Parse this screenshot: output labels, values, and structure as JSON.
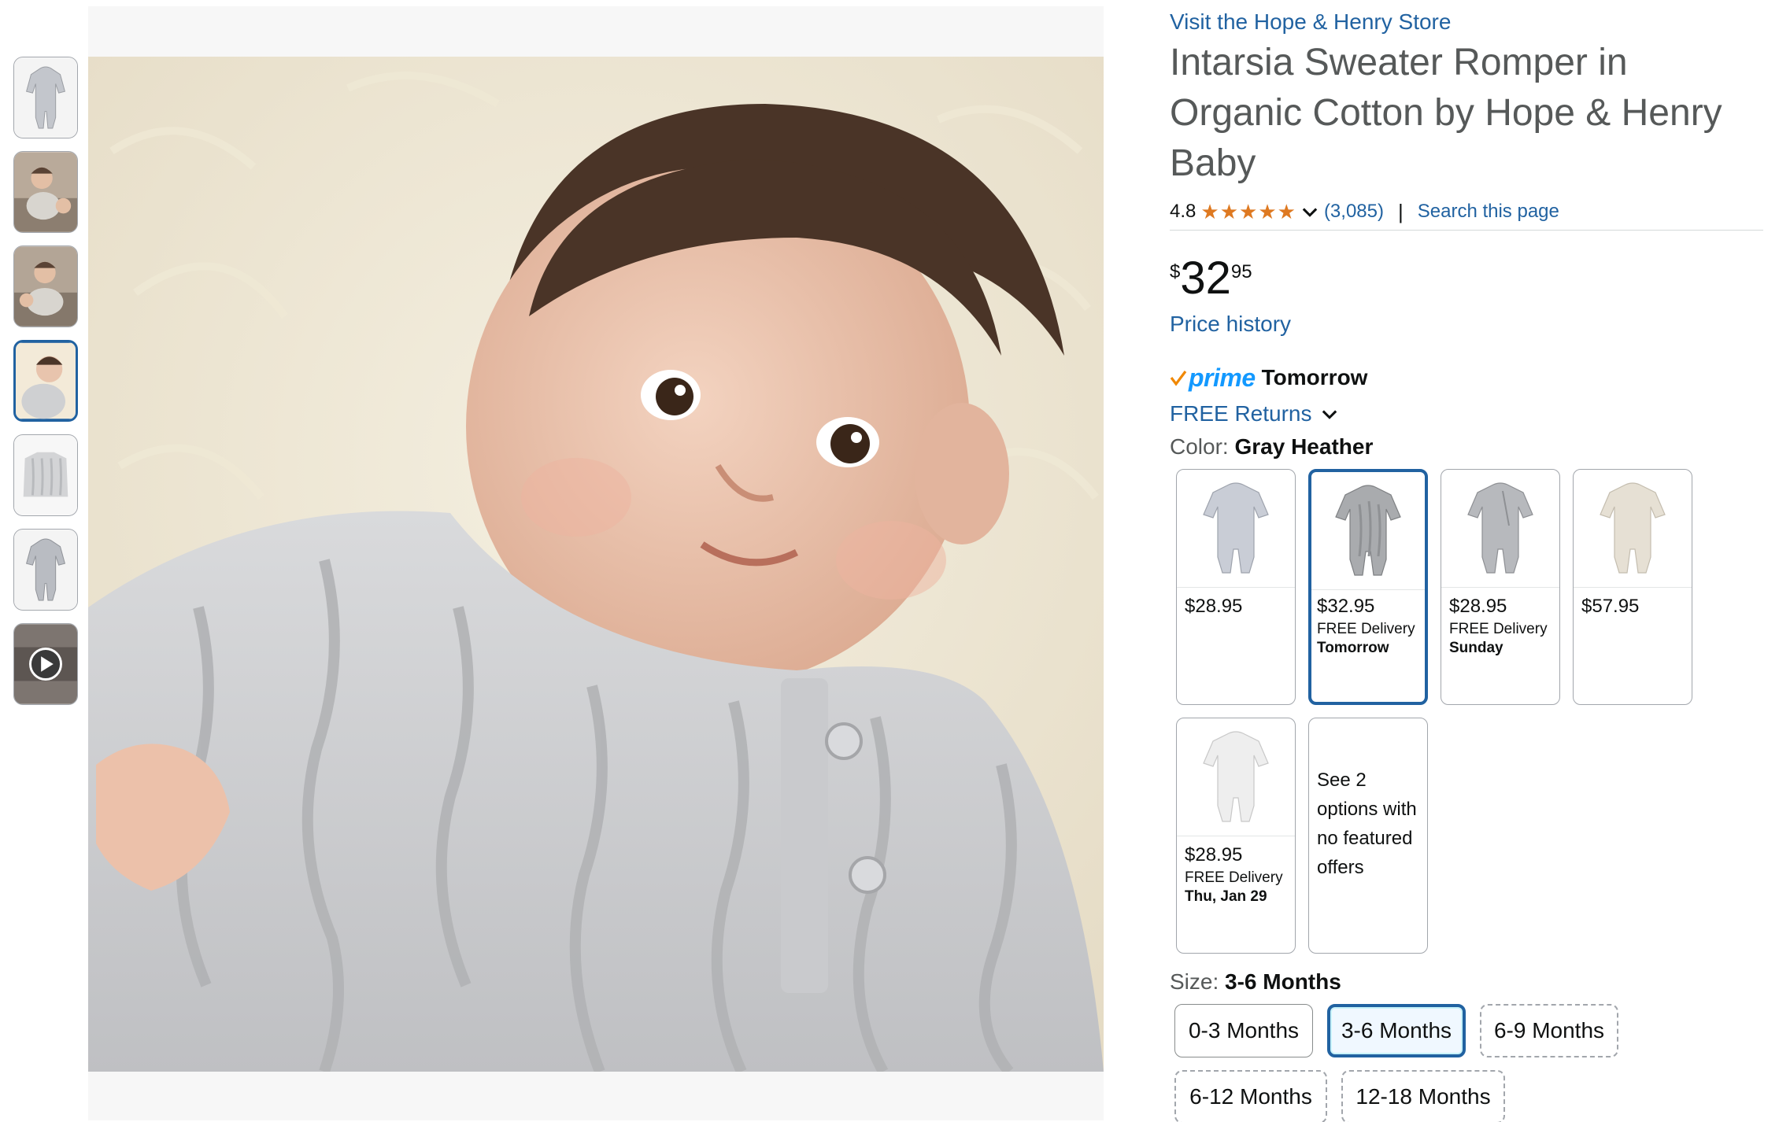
{
  "thumbnails": [
    {
      "name": "romper-gray-thumb"
    },
    {
      "name": "baby-lifestyle-thumb-1"
    },
    {
      "name": "baby-lifestyle-thumb-2"
    },
    {
      "name": "baby-closeup-thumb"
    },
    {
      "name": "sweater-detail-thumb"
    },
    {
      "name": "romper-flat-thumb"
    },
    {
      "name": "video-thumb"
    }
  ],
  "selected_thumbnail": 3,
  "store_link": "Visit the Hope & Henry Store",
  "title": "Intarsia Sweater Romper in Organic Cotton by Hope & Henry Baby",
  "rating": {
    "value": "4.8",
    "stars": 4.8,
    "count": "(3,085)",
    "separator": "|",
    "search_link": "Search this page"
  },
  "price": {
    "symbol": "$",
    "whole": "32",
    "fraction": "95"
  },
  "price_history": "Price history",
  "delivery": {
    "prime": "prime",
    "when": "Tomorrow",
    "returns": "FREE Returns"
  },
  "color": {
    "label": "Color:",
    "value": "Gray Heather"
  },
  "swatches": [
    {
      "price": "$28.95",
      "delivery": "",
      "date": "",
      "tone": "#c9cdd6"
    },
    {
      "price": "$32.95",
      "delivery": "FREE Delivery",
      "date": "Tomorrow",
      "tone": "#a9abae",
      "selected": true
    },
    {
      "price": "$28.95",
      "delivery": "FREE Delivery",
      "date": "Sunday",
      "tone": "#b7b9bd"
    },
    {
      "price": "$57.95",
      "delivery": "",
      "date": "",
      "tone": "#e6e0d4"
    },
    {
      "price": "$28.95",
      "delivery": "FREE Delivery",
      "date": "Thu, Jan 29",
      "tone": "#eeeeee"
    }
  ],
  "see_options": "See 2 options with no featured offers",
  "size": {
    "label": "Size:",
    "value": "3-6 Months"
  },
  "sizes": [
    {
      "label": "0-3 Months",
      "style": "solid"
    },
    {
      "label": "3-6 Months",
      "style": "selected"
    },
    {
      "label": "6-9 Months",
      "style": "dashed"
    },
    {
      "label": "6-12 Months",
      "style": "dashed"
    },
    {
      "label": "12-18 Months",
      "style": "dashed"
    }
  ],
  "colors": {
    "link": "#2162a1",
    "star": "#de7921",
    "prime": "#1399ff",
    "selected_border": "#2162a1"
  }
}
